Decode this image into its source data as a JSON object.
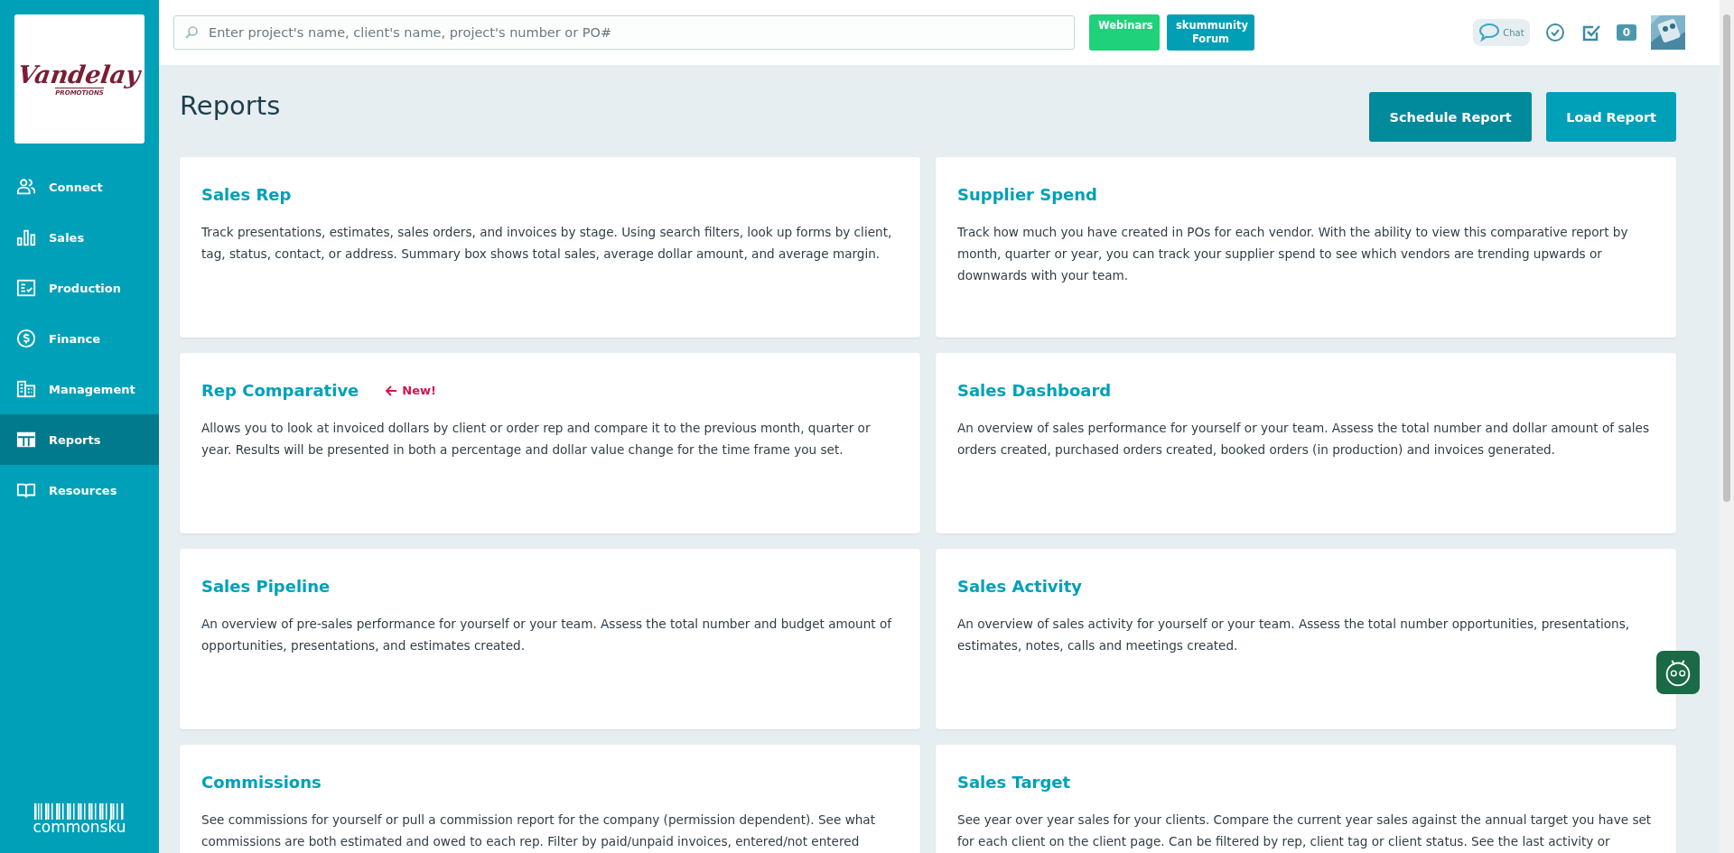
{
  "logo": {
    "name": "Vandelay",
    "tagline": "PROMOTIONS"
  },
  "sidebar": {
    "items": [
      {
        "label": "Connect",
        "selected": false
      },
      {
        "label": "Sales",
        "selected": false
      },
      {
        "label": "Production",
        "selected": false
      },
      {
        "label": "Finance",
        "selected": false
      },
      {
        "label": "Management",
        "selected": false
      },
      {
        "label": "Reports",
        "selected": true
      },
      {
        "label": "Resources",
        "selected": false
      }
    ],
    "brand": "commonsku"
  },
  "topbar": {
    "search": {
      "placeholder": "Enter project's name, client's name, project's number or PO#"
    },
    "links": [
      {
        "label": "Webinars",
        "color": "#1fd17a"
      },
      {
        "label": "skummunity Forum",
        "color": "#009fb5"
      }
    ],
    "chat": "Chat",
    "notifications": "0"
  },
  "page": {
    "title": "Reports",
    "actions": [
      {
        "label": "Schedule Report",
        "selected": true
      },
      {
        "label": "Load Report",
        "selected": false
      }
    ]
  },
  "reports": [
    {
      "title": "Sales Rep",
      "description": "Track presentations, estimates, sales orders, and invoices by stage. Using search filters, look up forms by client, tag, status, contact, or address. Summary box shows total sales, average dollar amount, and average margin."
    },
    {
      "title": "Supplier Spend",
      "description": "Track how much you have created in POs for each vendor. With the ability to view this comparative report by month, quarter or year, you can track your supplier spend to see which vendors are trending upwards or downwards with your team."
    },
    {
      "title": "Rep Comparative",
      "badge": "New!",
      "description": "Allows you to look at invoiced dollars by client or order rep and compare it to the previous month, quarter or year. Results will be presented in both a percentage and dollar value change for the time frame you set."
    },
    {
      "title": "Sales Dashboard",
      "description": "An overview of sales performance for yourself or your team. Assess the total number and dollar amount of sales orders created, purchased orders created, booked orders (in production) and invoices generated."
    },
    {
      "title": "Sales Pipeline",
      "description": "An overview of pre-sales performance for yourself or your team. Assess the total number and budget amount of opportunities, presentations, and estimates created."
    },
    {
      "title": "Sales Activity",
      "description": "An overview of sales activity for yourself or your team. Assess the total number opportunities, presentations, estimates, notes, calls and meetings created."
    },
    {
      "title": "Commissions",
      "description": "See commissions for yourself or pull a commission report for the company (permission dependent). See what commissions are both estimated and owed to each rep. Filter by paid/unpaid invoices, entered/not entered"
    },
    {
      "title": "Sales Target",
      "description": "See year over year sales for your clients. Compare the current year sales against the annual target you have set for each client on the client page. Can be filtered by rep, client tag or client status. See the last activity or"
    }
  ]
}
